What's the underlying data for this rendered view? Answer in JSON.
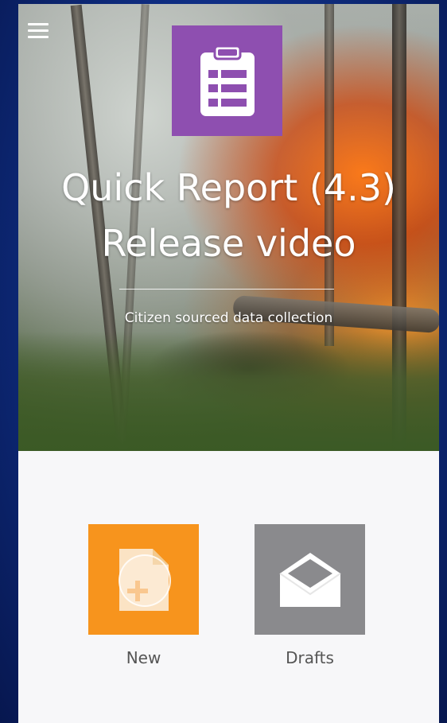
{
  "header": {
    "menu_icon": "hamburger-menu-icon",
    "app_icon": "clipboard-report-icon",
    "app_icon_color": "#8e4fb0",
    "title_line1": "Quick Report (4.3)",
    "title_line2": "Release video",
    "subtitle": "Citizen sourced data collection"
  },
  "actions": {
    "new": {
      "label": "New",
      "icon": "new-document-plus-icon",
      "color": "#f7941d"
    },
    "drafts": {
      "label": "Drafts",
      "icon": "envelope-open-icon",
      "color": "#8a8a8d"
    }
  }
}
